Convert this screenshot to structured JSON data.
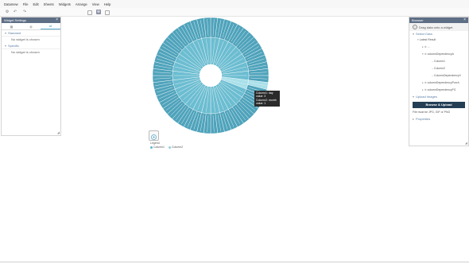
{
  "app": {
    "logo": "Datamew"
  },
  "menu": [
    "File",
    "Edit",
    "Sheets",
    "Widgets",
    "Arrange",
    "View",
    "Help"
  ],
  "widget_settings": {
    "title": "Widget Settings",
    "sections": [
      {
        "name": "Standard",
        "empty": "No widget is chosen"
      },
      {
        "name": "Specific",
        "empty": "No widget is chosen"
      }
    ]
  },
  "browser": {
    "title": "Browser",
    "info": "Drag data onto a widget",
    "select_data_label": "Select Data",
    "tree": [
      {
        "label": "Latest Result",
        "indent": 1
      },
      {
        "label": "...",
        "indent": 2
      },
      {
        "label": "columnDependencyA",
        "indent": 2
      },
      {
        "label": "Column1",
        "indent": 3
      },
      {
        "label": "Column2",
        "indent": 3
      },
      {
        "label": "ColumnDependencyV",
        "indent": 3
      },
      {
        "label": "columnDependencyPurch",
        "indent": 2
      },
      {
        "label": "columnDependencyFG",
        "indent": 2
      },
      {
        "label": "...",
        "indent": 2
      }
    ],
    "upload_label": "Upload Images",
    "browse_button": "Browse & Upload",
    "file_note": "File must be JPG, GIF or PNG",
    "properties_label": "Properties"
  },
  "tooltip": {
    "line1": "Column1: day",
    "line2": "value: 3",
    "line3": "Column2: month",
    "line4": "value: 1"
  },
  "legend": {
    "title": "Legend",
    "items": [
      "Column1",
      "Column2"
    ]
  },
  "chart_data": {
    "type": "sunburst",
    "inner_ring_segments": 26,
    "outer_ring_segments": 52,
    "highlighted_segment": {
      "Column1": "day",
      "Column2": "month"
    },
    "colors": {
      "outer": "#4fa3bb",
      "inner": "#6cbdd1",
      "highlight": "#a9e0ea",
      "center": "#ffffff"
    }
  }
}
